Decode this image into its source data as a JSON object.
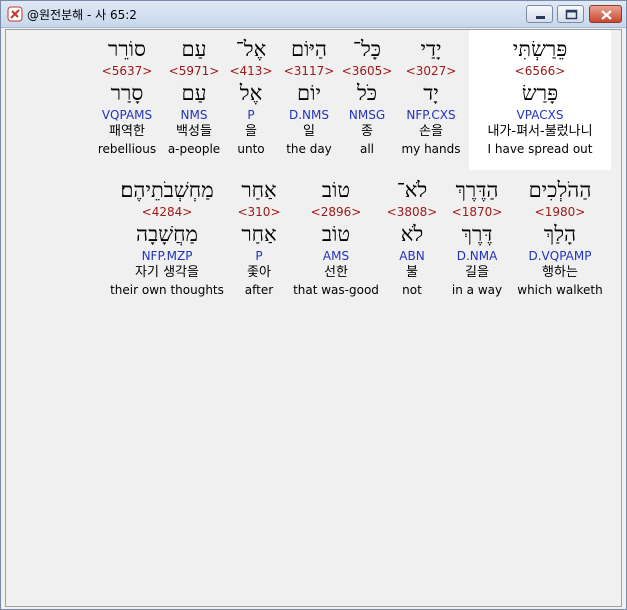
{
  "window": {
    "title": "@원전분해 - 사 65:2"
  },
  "rows": [
    {
      "words": [
        {
          "hebrew": "פֵּרַשְׂתִּי",
          "strong": "<6566>",
          "lemma": "פָּרַשׂ",
          "morph": "VPACXS",
          "korean": "내가-펴서-불렀나니",
          "english": "I have spread out",
          "highlight": true
        },
        {
          "hebrew": "יָדַי",
          "strong": "<3027>",
          "lemma": "יָד",
          "morph": "NFP.CXS",
          "korean": "손을",
          "english": "my hands"
        },
        {
          "hebrew": "כָּל־",
          "strong": "<3605>",
          "lemma": "כֹּל",
          "morph": "NMSG",
          "korean": "종",
          "english": "all"
        },
        {
          "hebrew": "הַיּוֹם",
          "strong": "<3117>",
          "lemma": "יוֹם",
          "morph": "D.NMS",
          "korean": "일",
          "english": "the day"
        },
        {
          "hebrew": "אֶל־",
          "strong": "<413>",
          "lemma": "אֶל",
          "morph": "P",
          "korean": "을",
          "english": "unto"
        },
        {
          "hebrew": "עַם",
          "strong": "<5971>",
          "lemma": "עַם",
          "morph": "NMS",
          "korean": "백성들",
          "english": "a-people"
        },
        {
          "hebrew": "סוֹרֵר",
          "strong": "<5637>",
          "lemma": "סָרַר",
          "morph": "VQPAMS",
          "korean": "패역한",
          "english": "rebellious"
        }
      ]
    },
    {
      "words": [
        {
          "hebrew": "הַהֹלְכִים",
          "strong": "<1980>",
          "lemma": "הָלַךְ",
          "morph": "D.VQPAMP",
          "korean": "행하는",
          "english": "which walketh"
        },
        {
          "hebrew": "הַדֶּרֶךְ",
          "strong": "<1870>",
          "lemma": "דֶּרֶךְ",
          "morph": "D.NMA",
          "korean": "길을",
          "english": "in a way"
        },
        {
          "hebrew": "לֹא־",
          "strong": "<3808>",
          "lemma": "לֹא",
          "morph": "ABN",
          "korean": "불",
          "english": "not"
        },
        {
          "hebrew": "טוֹב",
          "strong": "<2896>",
          "lemma": "טוֹב",
          "morph": "AMS",
          "korean": "선한",
          "english": "that was-good"
        },
        {
          "hebrew": "אַחַר",
          "strong": "<310>",
          "lemma": "אַחַר",
          "morph": "P",
          "korean": "좇아",
          "english": "after"
        },
        {
          "hebrew": "מַחְשְׁבֹתֵיהֶם׃",
          "strong": "<4284>",
          "lemma": "מַחֲשָׁבָה",
          "morph": "NFP.MZP",
          "korean": "자기 생각을",
          "english": "their own thoughts"
        }
      ]
    }
  ]
}
